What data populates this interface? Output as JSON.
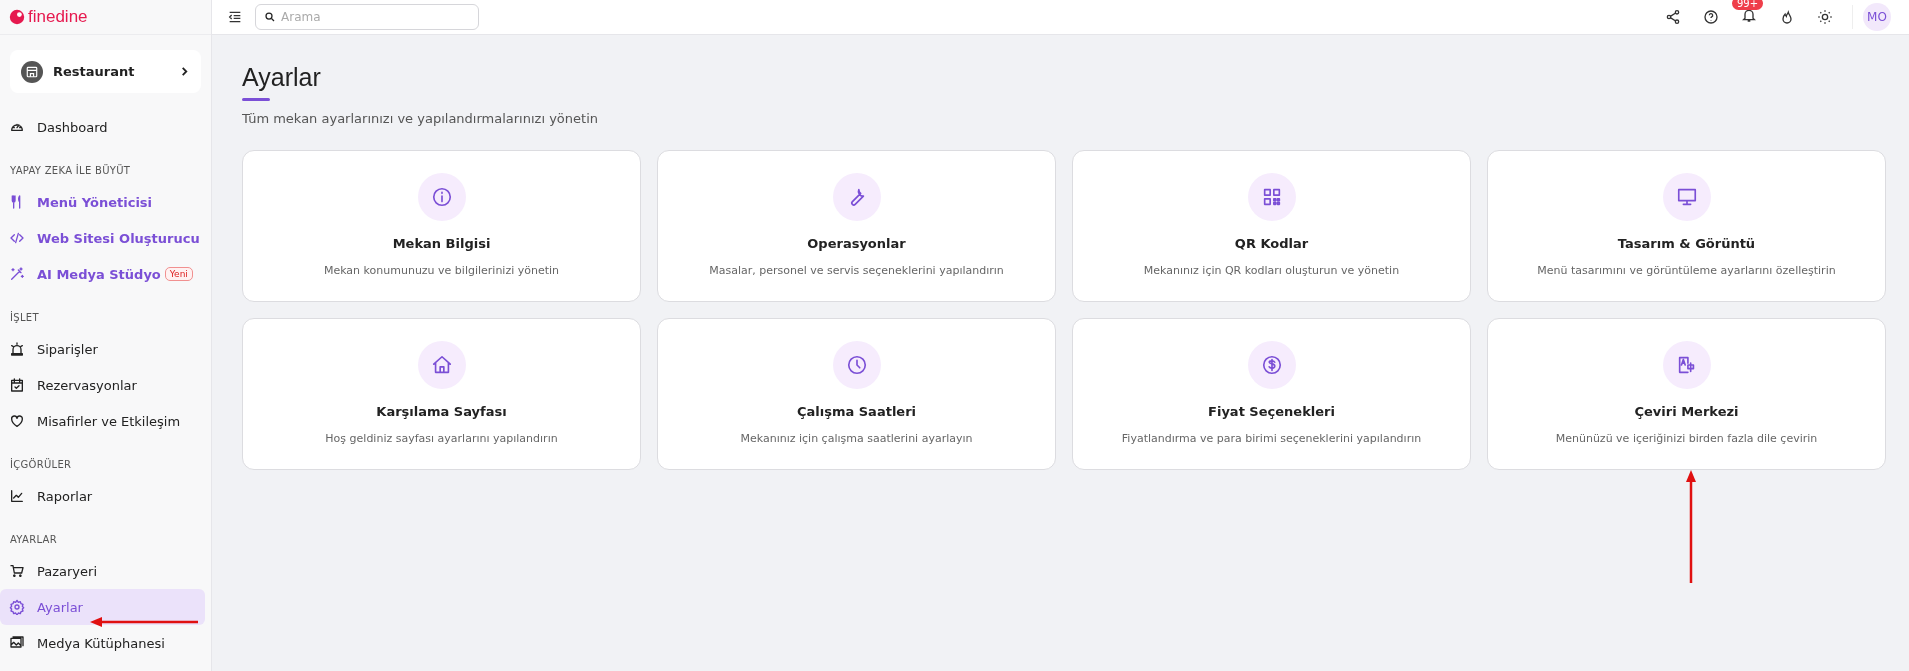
{
  "sidebar": {
    "logo": "finedine",
    "venue": "Restaurant",
    "sections": [
      {
        "items": [
          {
            "label": "Dashboard",
            "kind": "plain",
            "selected": false
          }
        ]
      },
      {
        "heading": "YAPAY ZEKA İLE BÜYÜT",
        "items": [
          {
            "label": "Menü Yöneticisi",
            "kind": "ai",
            "selected": false
          },
          {
            "label": "Web Sitesi Oluşturucu",
            "kind": "ai",
            "selected": false
          },
          {
            "label": "AI Medya Stüdyo",
            "kind": "ai",
            "selected": false,
            "badge": "Yeni"
          }
        ]
      },
      {
        "heading": "İŞLET",
        "items": [
          {
            "label": "Siparişler",
            "kind": "plain",
            "selected": false
          },
          {
            "label": "Rezervasyonlar",
            "kind": "plain",
            "selected": false
          },
          {
            "label": "Misafirler ve Etkileşim",
            "kind": "plain",
            "selected": false
          }
        ]
      },
      {
        "heading": "İÇGÖRÜLER",
        "items": [
          {
            "label": "Raporlar",
            "kind": "plain",
            "selected": false
          }
        ]
      },
      {
        "heading": "AYARLAR",
        "items": [
          {
            "label": "Pazaryeri",
            "kind": "plain",
            "selected": false
          },
          {
            "label": "Ayarlar",
            "kind": "plain",
            "selected": true
          },
          {
            "label": "Medya Kütüphanesi",
            "kind": "plain",
            "selected": false
          }
        ]
      }
    ]
  },
  "topbar": {
    "search": {
      "placeholder": "Arama"
    },
    "notification_count": "99+",
    "avatar": "MO"
  },
  "page": {
    "title": "Ayarlar",
    "subtitle": "Tüm mekan ayarlarınızı ve yapılandırmalarınızı yönetin"
  },
  "cards": [
    {
      "title": "Mekan Bilgisi",
      "description": "Mekan konumunuzu ve bilgilerinizi yönetin"
    },
    {
      "title": "Operasyonlar",
      "description": "Masalar, personel ve servis seçeneklerini yapılandırın"
    },
    {
      "title": "QR Kodlar",
      "description": "Mekanınız için QR kodları oluşturun ve yönetin"
    },
    {
      "title": "Tasarım & Görüntü",
      "description": "Menü tasarımını ve görüntüleme ayarlarını özelleştirin"
    },
    {
      "title": "Karşılama Sayfası",
      "description": "Hoş geldiniz sayfası ayarlarını yapılandırın"
    },
    {
      "title": "Çalışma Saatleri",
      "description": "Mekanınız için çalışma saatlerini ayarlayın"
    },
    {
      "title": "Fiyat Seçenekleri",
      "description": "Fiyatlandırma ve para birimi seçeneklerini yapılandırın"
    },
    {
      "title": "Çeviri Merkezi",
      "description": "Menünüzü ve içeriğinizi birden fazla dile çevirin"
    }
  ]
}
